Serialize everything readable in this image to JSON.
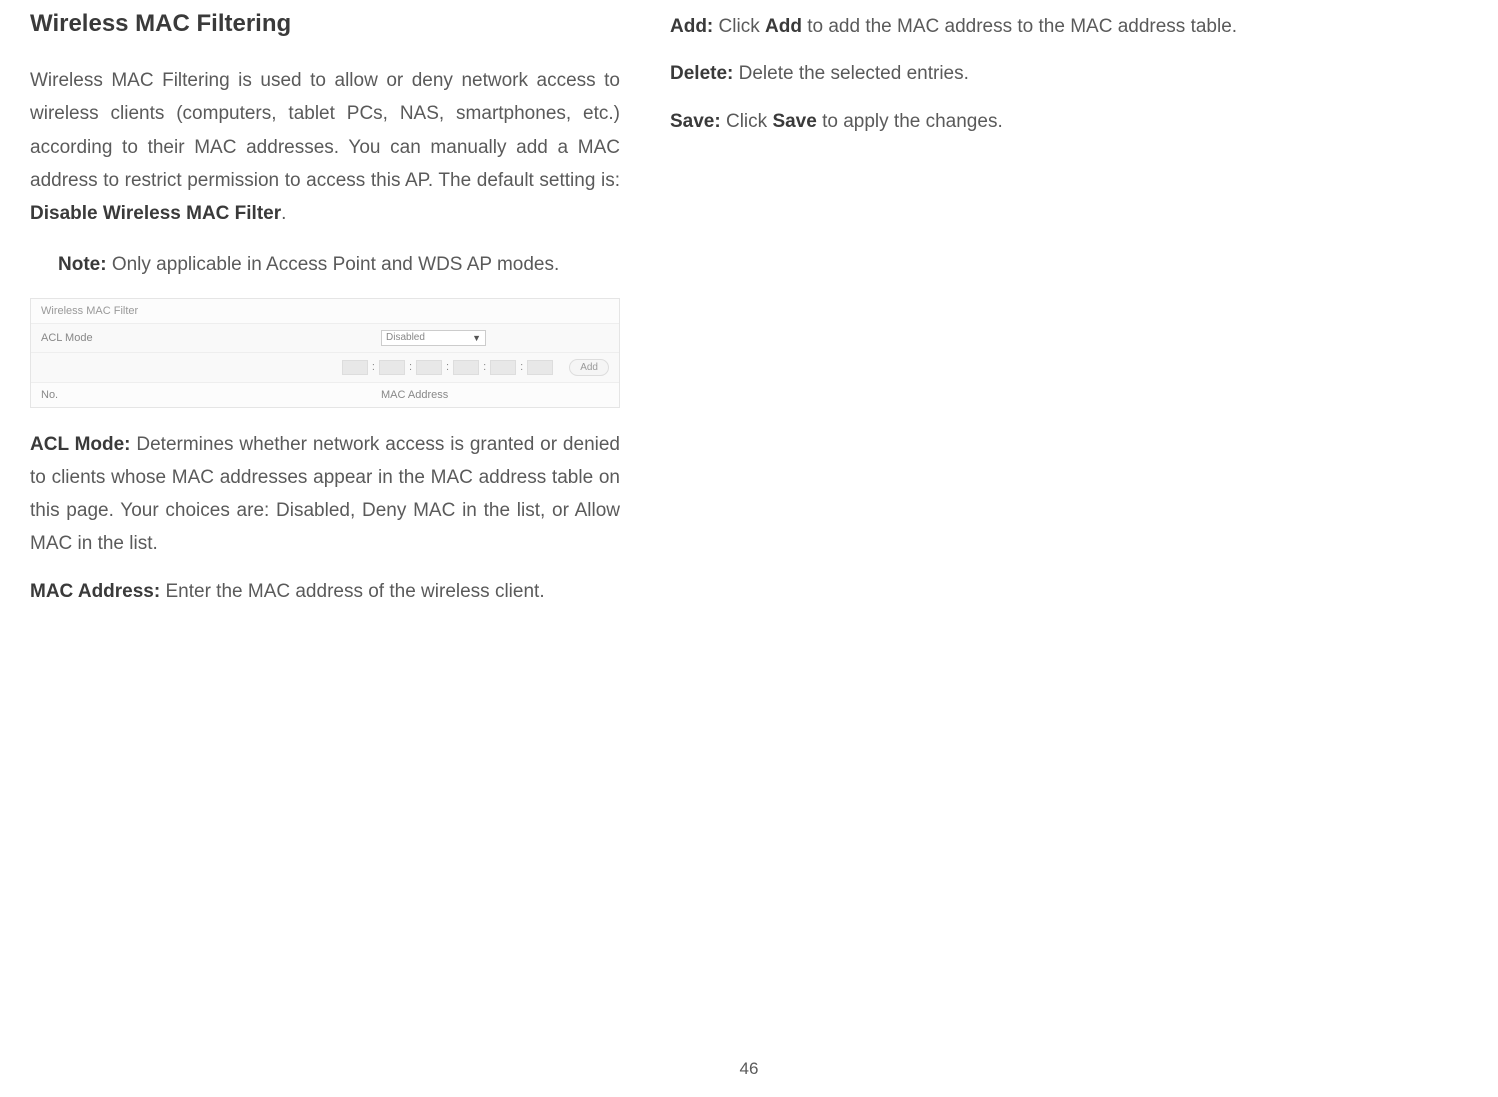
{
  "heading": "Wireless MAC Filtering",
  "intro": {
    "part1": "Wireless MAC Filtering is used to allow or deny network access to wireless clients (computers, tablet PCs, NAS, smartphones, etc.) according to their MAC addresses. You can manually add a MAC address to restrict permission to access this AP. The default setting is: ",
    "bold": "Disable Wireless MAC Filter",
    "part2": "."
  },
  "note": {
    "label": "Note:",
    "text": "  Only applicable in Access Point and WDS AP modes."
  },
  "screenshot": {
    "title": "Wireless MAC Filter",
    "acl_label": "ACL Mode",
    "acl_value": "Disabled",
    "add_button": "Add",
    "col_no": "No.",
    "col_mac": "MAC Address"
  },
  "defs": {
    "acl_mode": {
      "term": "ACL Mode:",
      "text": " Determines whether network access is granted or denied to clients whose MAC addresses appear in the MAC address table on this page. Your choices are: Disabled, Deny MAC in the list, or Allow MAC in the list."
    },
    "mac_address": {
      "term": "MAC Address:",
      "text": " Enter the MAC address of the wireless client."
    },
    "add": {
      "term": "Add:",
      "text1": " Click ",
      "bold": "Add",
      "text2": " to add the MAC address to the MAC address table."
    },
    "delete": {
      "term": "Delete:",
      "text": " Delete the selected entries."
    },
    "save": {
      "term": "Save:",
      "text1": " Click ",
      "bold": "Save",
      "text2": " to apply the changes."
    }
  },
  "page_number": "46"
}
